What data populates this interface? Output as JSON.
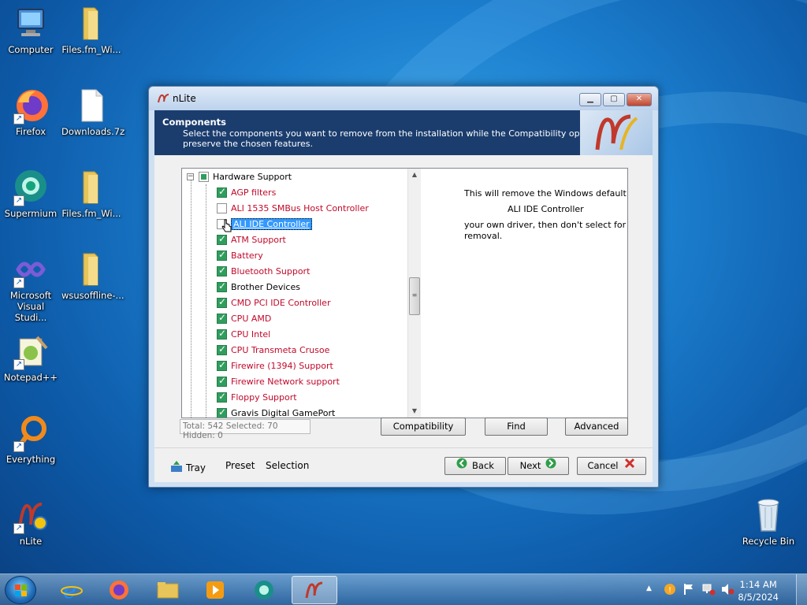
{
  "desktop": {
    "icons": [
      {
        "label": "Computer"
      },
      {
        "label": "Files.fm_Wi..."
      },
      {
        "label": "Firefox"
      },
      {
        "label": "Downloads.7z"
      },
      {
        "label": "Supermium"
      },
      {
        "label": "Files.fm_Wi..."
      },
      {
        "label": "Microsoft Visual Studi..."
      },
      {
        "label": "wsusoffline-..."
      },
      {
        "label": "Notepad++"
      },
      {
        "label": "Everything"
      },
      {
        "label": "nLite"
      },
      {
        "label": "Recycle Bin"
      }
    ]
  },
  "window": {
    "title": "nLite",
    "header_title": "Components",
    "header_desc_line1": "Select the components you want to remove from the installation while the Compatibility options",
    "header_desc_line2": "preserve the chosen features.",
    "tree": {
      "root": "Hardware Support",
      "items": [
        {
          "label": "AGP filters",
          "checked": true,
          "color": "red"
        },
        {
          "label": "ALI 1535 SMBus Host Controller",
          "checked": false,
          "color": "red"
        },
        {
          "label": "ALI IDE Controller",
          "checked": false,
          "color": "selected"
        },
        {
          "label": "ATM Support",
          "checked": true,
          "color": "red"
        },
        {
          "label": "Battery",
          "checked": true,
          "color": "red"
        },
        {
          "label": "Bluetooth Support",
          "checked": true,
          "color": "red"
        },
        {
          "label": "Brother Devices",
          "checked": true,
          "color": "black"
        },
        {
          "label": "CMD PCI IDE Controller",
          "checked": true,
          "color": "red"
        },
        {
          "label": "CPU AMD",
          "checked": true,
          "color": "red"
        },
        {
          "label": "CPU Intel",
          "checked": true,
          "color": "red"
        },
        {
          "label": "CPU Transmeta Crusoe",
          "checked": true,
          "color": "red"
        },
        {
          "label": "Firewire (1394) Support",
          "checked": true,
          "color": "red"
        },
        {
          "label": "Firewire Network support",
          "checked": true,
          "color": "red"
        },
        {
          "label": "Floppy Support",
          "checked": true,
          "color": "red"
        },
        {
          "label": "Gravis Digital GamePort",
          "checked": true,
          "color": "black"
        }
      ]
    },
    "info": {
      "line1": "This will remove the Windows default",
      "line2": "ALI IDE Controller",
      "line3": "your own driver, then don't select for",
      "line4": "removal."
    },
    "status": "Total: 542 Selected: 70 Hidden: 0",
    "buttons": {
      "compatibility": "Compatibility",
      "find": "Find",
      "advanced": "Advanced",
      "back": "Back",
      "next": "Next",
      "cancel": "Cancel"
    },
    "bottom_links": {
      "tray": "Tray",
      "preset": "Preset",
      "selection": "Selection"
    }
  },
  "taskbar": {
    "time": "1:14 AM",
    "date": "8/5/2024"
  },
  "colors": {
    "header_bg": "#1b3d6e",
    "unsupported_text": "#c00a2a",
    "checkbox_green": "#2f9e5d",
    "selection_blue": "#3399ff"
  }
}
